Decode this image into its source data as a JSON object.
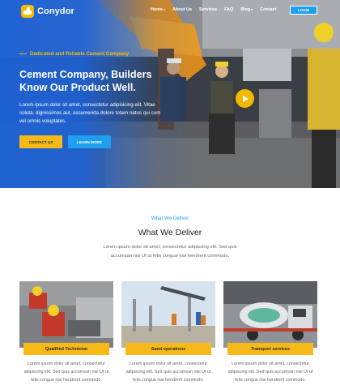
{
  "brand": {
    "name": "Conydor"
  },
  "nav": {
    "items": [
      {
        "label": "Home",
        "has_dropdown": true
      },
      {
        "label": "About Us",
        "has_dropdown": false
      },
      {
        "label": "Services",
        "has_dropdown": false
      },
      {
        "label": "FAQ",
        "has_dropdown": false
      },
      {
        "label": "Blog",
        "has_dropdown": true
      },
      {
        "label": "Contact",
        "has_dropdown": false
      }
    ],
    "login_label": "LOGIN"
  },
  "hero": {
    "eyebrow": "Dedicated and Reliable Cement Company",
    "title": "Cement Company, Builders Know Our Product Well.",
    "description": "Lorem ipsum dolor sit amet, consectetur adipisicing elit. Vitae soluta, dignissimos aut, assumenda dolore totam natus qui cum vel omnis voluptates.",
    "contact_button": "CONTACT US",
    "learn_button": "LEARN MORE",
    "play_icon": "play-icon"
  },
  "deliver": {
    "eyebrow": "What We Deliver",
    "title": "What We Deliver",
    "description": "Lorem ipsum dolor sit amet, consectetur adipiscing elit. Sed quis accumsan nisi Ut ut felis congue nisl hendrerit commodo.",
    "cards": [
      {
        "label": "Qualified Technician",
        "text": "Lorem ipsum dolor sit amet, consectetur adipiscing elit. Sed quis accumsan nisi Ut ut felis congue nisl hendrerit commodo."
      },
      {
        "label": "Sand operations",
        "text": "Lorem ipsum dolor sit amet, consectetur adipiscing elit. Sed quis accumsan nisi Ut ut felis congue nisl hendrerit commodo."
      },
      {
        "label": "Transport services",
        "text": "Lorem ipsum dolor sit amet, consectetur adipiscing elit. Sed quis accumsan nisi Ut ut felis congue nisl hendrerit commodo."
      }
    ]
  },
  "colors": {
    "primary_blue": "#1e9ff0",
    "hero_blue": "#1d62d6",
    "accent_yellow": "#f7b918"
  }
}
